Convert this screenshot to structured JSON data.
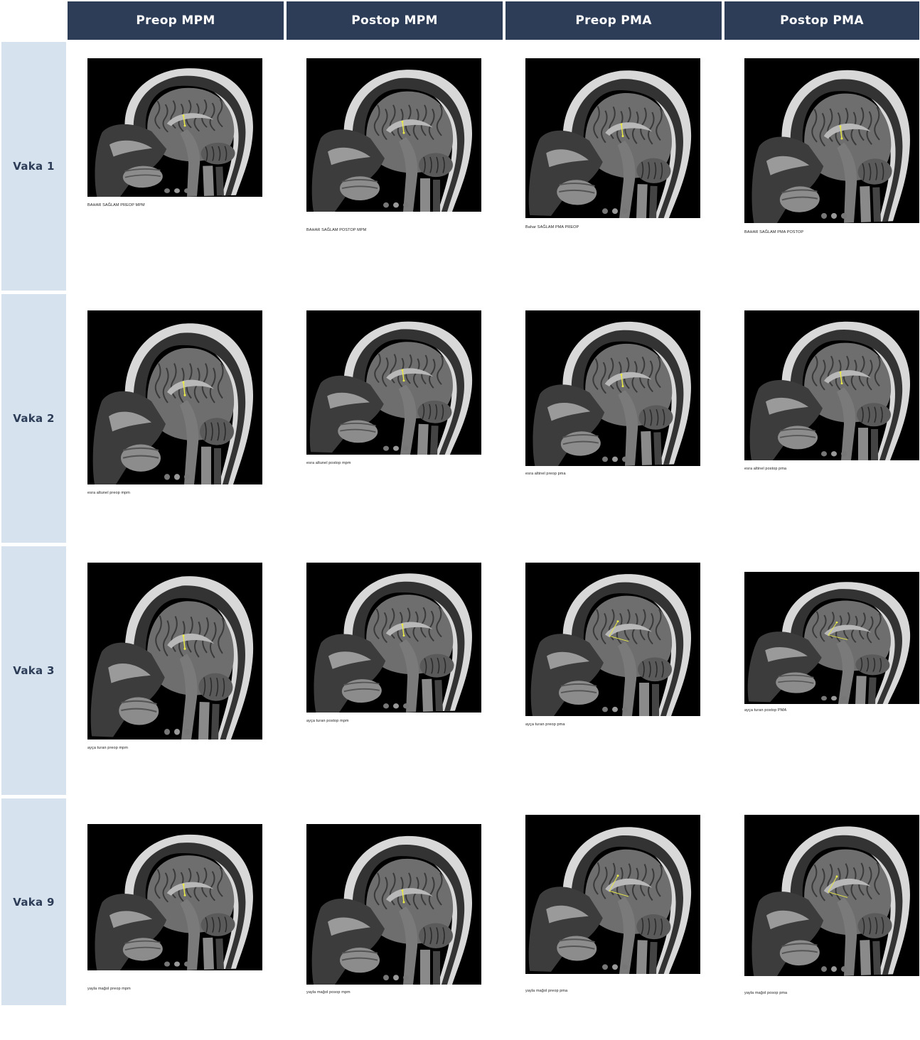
{
  "columns": [
    "Preop MPM",
    "Postop MPM",
    "Preop PMA",
    "Postop PMA"
  ],
  "rows": [
    {
      "label": "Vaka 1",
      "cells": [
        {
          "caption": "BAHAR SAĞLAM PREOP MPM"
        },
        {
          "caption": "BAHAR SAĞLAM POSTOP MPM"
        },
        {
          "caption": "Bahar SAĞLAM PMA PREOP"
        },
        {
          "caption": "BAHAR SAĞLAM PMA POSTOP"
        }
      ]
    },
    {
      "label": "Vaka 2",
      "cells": [
        {
          "caption": "esra altunel preop mpm"
        },
        {
          "caption": "esra altunel postop mpm"
        },
        {
          "caption": "esra altinel preop pma"
        },
        {
          "caption": "esra altinel postop pma"
        }
      ]
    },
    {
      "label": "Vaka 3",
      "cells": [
        {
          "caption": "ayça turan preop mpm"
        },
        {
          "caption": "ayça turan postop mpm"
        },
        {
          "caption": "ayça turan preop pma"
        },
        {
          "caption": "ayça turan postop PMA"
        }
      ]
    },
    {
      "label": "Vaka 9",
      "cells": [
        {
          "caption": "yayla mağol preop mpm"
        },
        {
          "caption": "yayla mağol posop mpm"
        },
        {
          "caption": "yayla mağol preop pma"
        },
        {
          "caption": "yayla mağol posop pma"
        }
      ]
    }
  ]
}
